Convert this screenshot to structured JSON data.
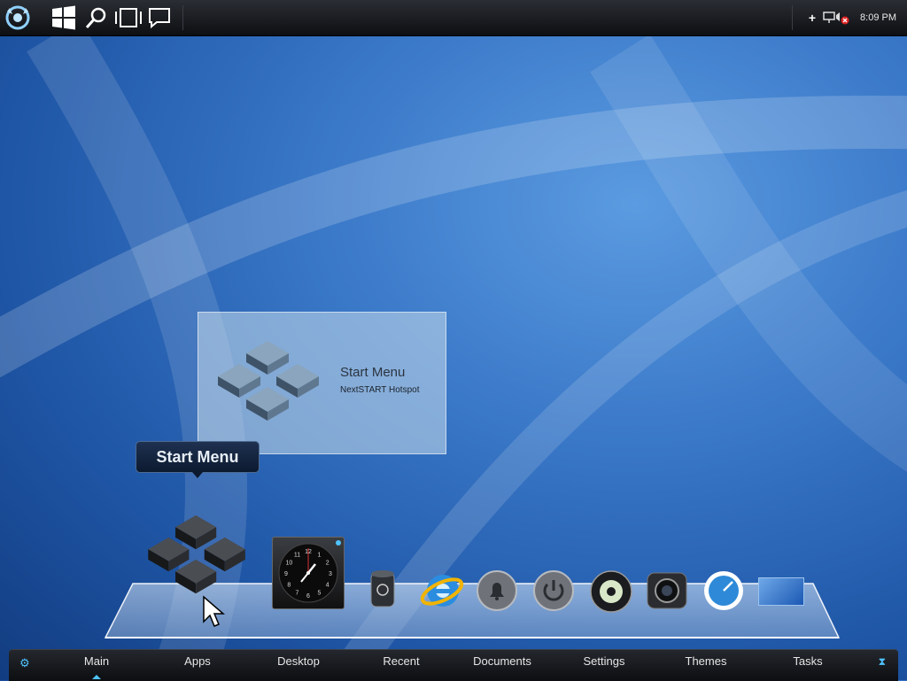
{
  "topbar": {
    "icons": [
      "nextstart-logo-icon",
      "windows-icon",
      "search-icon",
      "task-view-icon",
      "chat-icon"
    ],
    "tray": {
      "icons": [
        "plus-icon",
        "network-icon",
        "volume-muted-icon"
      ],
      "clock": "8:09 PM"
    }
  },
  "hotspot": {
    "title": "Start Menu",
    "subtitle": "NextSTART Hotspot"
  },
  "label_bubble": "Start Menu",
  "dock": {
    "items": [
      {
        "name": "start-menu-icon"
      },
      {
        "name": "clock-widget",
        "numbers": [
          "12",
          "1",
          "2",
          "3",
          "4",
          "5",
          "6",
          "7",
          "8",
          "9",
          "10",
          "11"
        ]
      },
      {
        "name": "recycle-bin-icon"
      },
      {
        "name": "internet-explorer-icon"
      },
      {
        "name": "notifications-bell-icon"
      },
      {
        "name": "power-icon"
      },
      {
        "name": "media-player-icon"
      },
      {
        "name": "camera-icon"
      },
      {
        "name": "speedometer-icon"
      },
      {
        "name": "desktop-thumbnail-icon"
      }
    ]
  },
  "bottom_nav": {
    "tabs": [
      "Main",
      "Apps",
      "Desktop",
      "Recent",
      "Documents",
      "Settings",
      "Themes",
      "Tasks"
    ],
    "active": "Main"
  },
  "colors": {
    "accent": "#4fc3ff",
    "bar_bg": "#15171b",
    "desktop": "#2f6bbf"
  }
}
